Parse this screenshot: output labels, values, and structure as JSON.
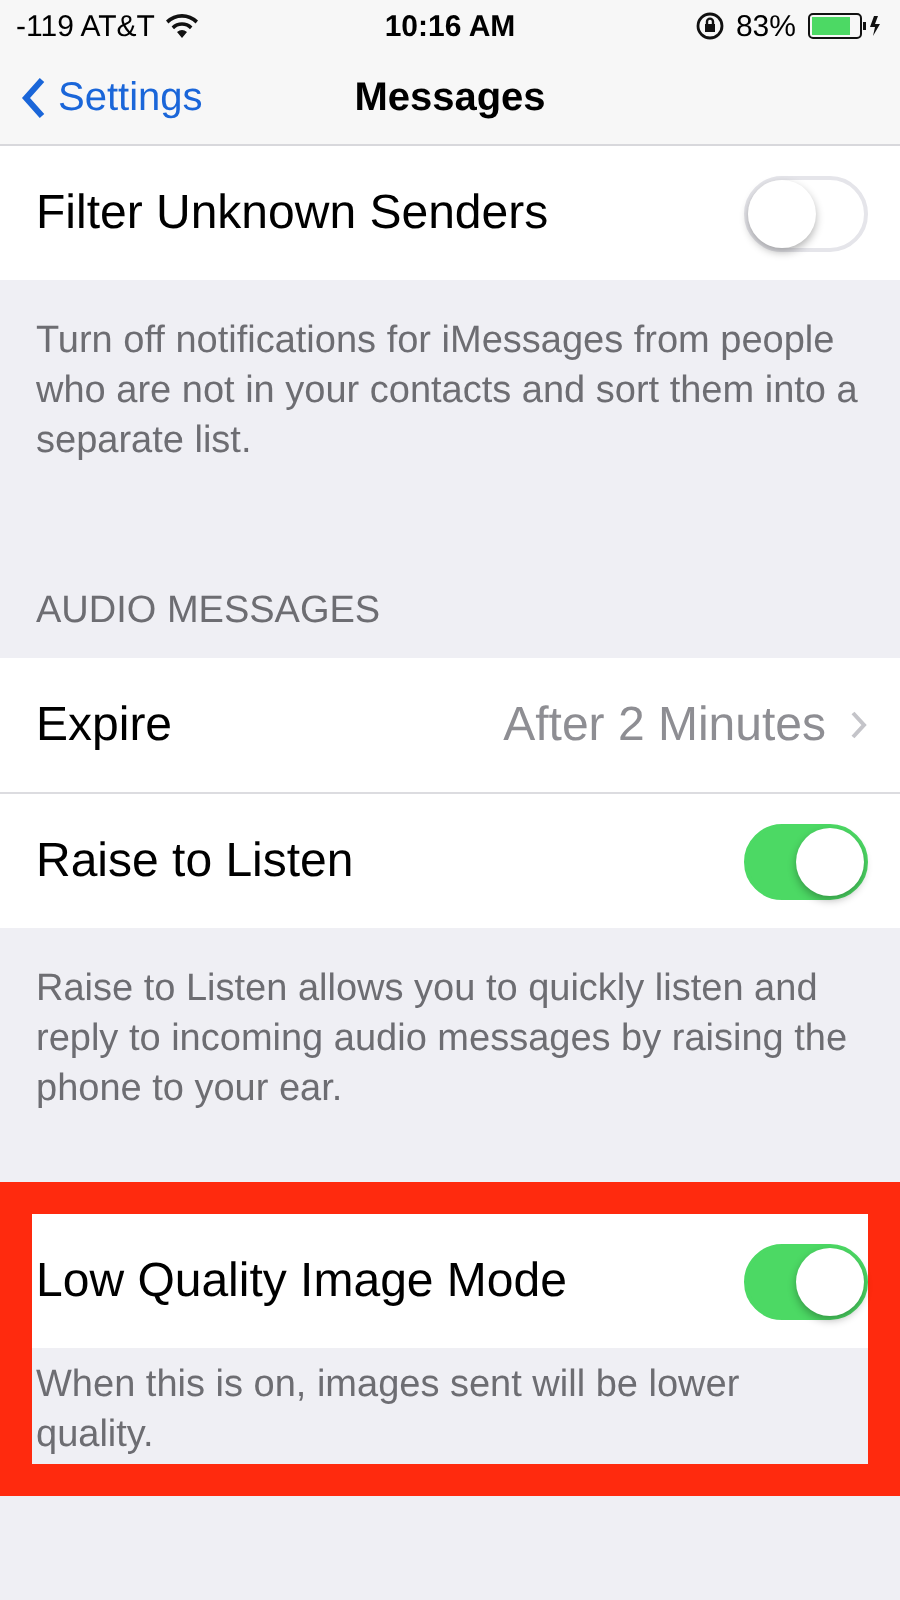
{
  "status_bar": {
    "carrier": "-119 AT&T",
    "time": "10:16 AM",
    "battery": "83%"
  },
  "nav": {
    "back": "Settings",
    "title": "Messages"
  },
  "sections": [
    {
      "highlighted": false,
      "rows": [
        {
          "kind": "toggle",
          "label": "Filter Unknown Senders",
          "on": false
        }
      ],
      "footer": "Turn off notifications for iMessages from people who are not in your contacts and sort them into a separate list."
    },
    {
      "highlighted": false,
      "header": "AUDIO MESSAGES",
      "rows": [
        {
          "kind": "detail",
          "label": "Expire",
          "value": "After 2 Minutes"
        },
        {
          "kind": "toggle",
          "label": "Raise to Listen",
          "on": true
        }
      ],
      "footer": "Raise to Listen allows you to quickly listen and reply to incoming audio messages by raising the phone to your ear."
    },
    {
      "highlighted": true,
      "rows": [
        {
          "kind": "toggle",
          "label": "Low Quality Image Mode",
          "on": true
        }
      ],
      "footer": "When this is on, images sent will be lower quality."
    }
  ]
}
